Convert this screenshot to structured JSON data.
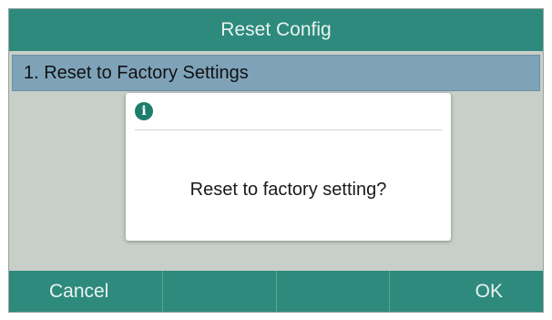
{
  "title": "Reset Config",
  "menu": {
    "items": [
      {
        "label": "1. Reset to Factory Settings"
      }
    ]
  },
  "dialog": {
    "icon": "info-icon",
    "message": "Reset to factory setting?"
  },
  "softkeys": {
    "cancel": "Cancel",
    "slot2": "",
    "slot3": "",
    "ok": "OK"
  },
  "colors": {
    "accent": "#2d8a7c",
    "selection": "#7ea3b9",
    "background": "#c7cfc8"
  }
}
